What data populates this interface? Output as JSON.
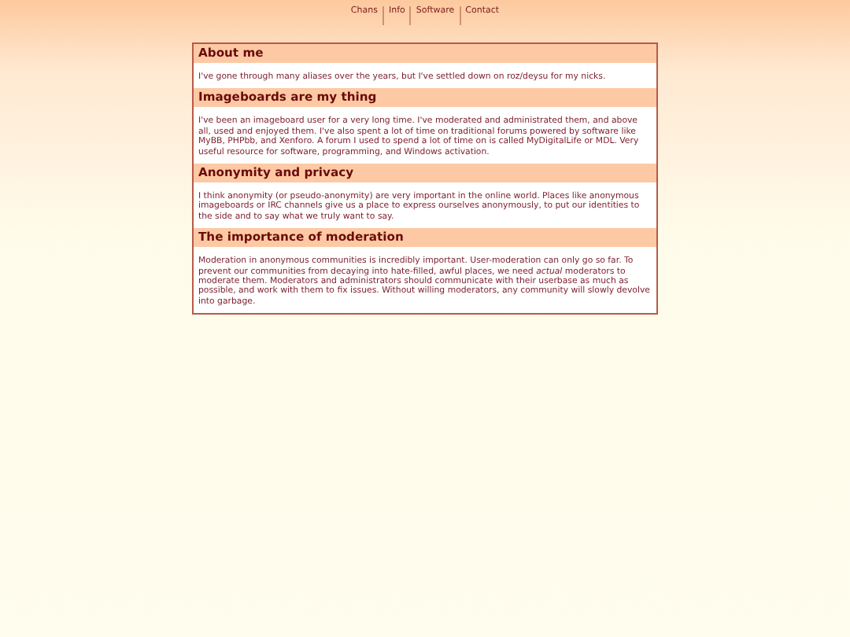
{
  "nav": [
    "Chans",
    "Info",
    "Software",
    "Contact"
  ],
  "sections": [
    {
      "heading": "About me",
      "text": "I've gone through many aliases over the years, but I've settled down on roz/deysu for my nicks."
    },
    {
      "heading": "Imageboards are my thing",
      "text": "I've been an imageboard user for a very long time. I've moderated and administrated them, and above all, used and enjoyed them. I've also spent a lot of time on traditional forums powered by software like MyBB, PHPbb, and Xenforo. A forum I used to spend a lot of time on is called MyDigitalLife or MDL. Very useful resource for software, programming, and Windows activation."
    },
    {
      "heading": "Anonymity and privacy",
      "text": "I think anonymity (or pseudo-anonymity) are very important in the online world. Places like anonymous imageboards or IRC channels give us a place to express ourselves anonymously, to put our identities to the side and to say what we truly want to say."
    },
    {
      "heading": "The importance of moderation",
      "text": "Moderation in anonymous communities is incredibly important. User-moderation can only go so far. To prevent our communities from decaying into hate-filled, awful places, we need *actual* moderators to moderate them. Moderators and administrators should communicate with their userbase as much as possible, and work with them to fix issues. Without willing moderators, any community will slowly devolve into garbage."
    }
  ]
}
